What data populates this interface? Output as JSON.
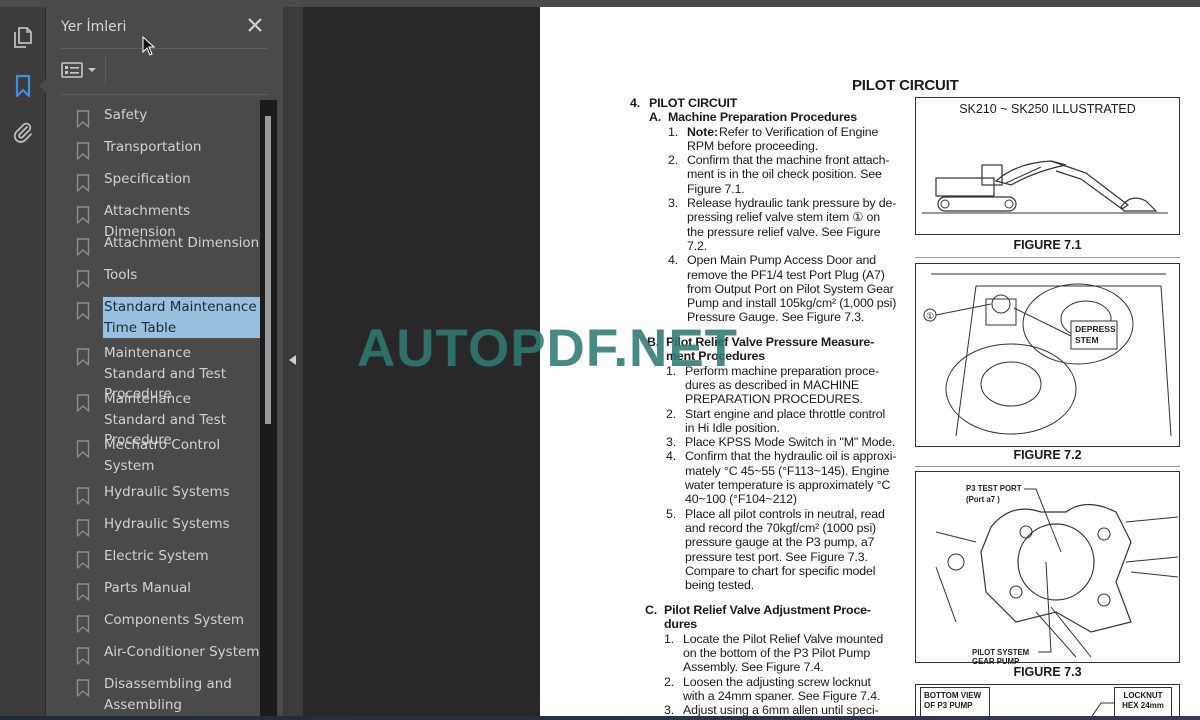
{
  "sidebar_rail": {
    "icons": [
      "pages-icon",
      "bookmark-icon",
      "attachment-icon"
    ],
    "active": "bookmark-icon"
  },
  "bookmarks_panel": {
    "title": "Yer İmleri",
    "close_label": "✕",
    "options_label": "Bookmark options",
    "items": [
      {
        "label": "Safety",
        "selected": false
      },
      {
        "label": "Transportation",
        "selected": false
      },
      {
        "label": "Specification",
        "selected": false
      },
      {
        "label": "Attachments Dimension",
        "selected": false
      },
      {
        "label": "Attachment Dimension",
        "selected": false
      },
      {
        "label": "Tools",
        "selected": false
      },
      {
        "label": "Standard Maintenance Time Table",
        "selected": true
      },
      {
        "label": "Maintenance Standard and Test Procedure",
        "selected": false
      },
      {
        "label": "Maintenance Standard and Test Procedure",
        "selected": false
      },
      {
        "label": "Mechatro Control System",
        "selected": false
      },
      {
        "label": "Hydraulic Systems",
        "selected": false
      },
      {
        "label": "Hydraulic Systems",
        "selected": false
      },
      {
        "label": "Electric System",
        "selected": false
      },
      {
        "label": "Parts Manual",
        "selected": false
      },
      {
        "label": "Components System",
        "selected": false
      },
      {
        "label": "Air-Conditioner System",
        "selected": false
      },
      {
        "label": "Disassembling and Assembling",
        "selected": false
      }
    ]
  },
  "watermark": "AUTOPDF.NET",
  "document": {
    "page_title": "PILOT CIRCUIT",
    "section": {
      "num": "4.",
      "title": "PILOT CIRCUIT"
    },
    "subsections": [
      {
        "letter": "A.",
        "title": "Machine Preparation Procedures",
        "steps": [
          {
            "num": "1.",
            "lead": "Note:",
            "lines": [
              "Refer to Verification of Engine",
              "RPM before proceeding."
            ]
          },
          {
            "num": "2.",
            "lines": [
              "Confirm that the machine front attach-",
              "ment is in the oil check position. See",
              "Figure 7.1."
            ]
          },
          {
            "num": "3.",
            "lines": [
              "Release hydraulic tank pressure by de-",
              "pressing relief valve stem item ① on",
              "the pressure relief valve. See Figure",
              "7.2."
            ]
          },
          {
            "num": "4.",
            "lines": [
              "Open Main Pump Access Door and",
              "remove the PF1/4 test Port Plug (A7)",
              "from Output Port on Pilot System Gear",
              "Pump and install 105kg/cm² (1,000 psi)",
              "Pressure Gauge. See Figure 7.3."
            ]
          }
        ]
      },
      {
        "letter": "B.",
        "title_lines": [
          "Pilot Relief Valve Pressure Measure-",
          "ment Procedures"
        ],
        "steps": [
          {
            "num": "1.",
            "lines": [
              "Perform machine preparation proce-",
              "dures as described in MACHINE",
              "PREPARATION PROCEDURES."
            ]
          },
          {
            "num": "2.",
            "lines": [
              "Start engine and place throttle control",
              "in Hi Idle position."
            ]
          },
          {
            "num": "3.",
            "lines": [
              "Place KPSS Mode Switch in \"M\" Mode."
            ]
          },
          {
            "num": "4.",
            "lines": [
              "Confirm that the hydraulic oil is approxi-",
              "mately °C 45~55 (°F113~145). Engine",
              "water temperature is approximately °C",
              "40~100 (°F104~212)"
            ]
          },
          {
            "num": "5.",
            "lines": [
              "Place all pilot controls in neutral, read",
              "and record the 70kgf/cm² (1000 psi)",
              "pressure gauge at the P3 pump, a7",
              "pressure test port. See Figure 7.3.",
              "Compare to chart for specific model",
              "being tested."
            ]
          }
        ]
      },
      {
        "letter": "C.",
        "title_lines": [
          "Pilot Relief Valve Adjustment Proce-",
          "dures"
        ],
        "steps": [
          {
            "num": "1.",
            "lines": [
              "Locate the Pilot Relief Valve mounted",
              "on the bottom of the P3 Pilot Pump",
              "Assembly. See Figure 7.4."
            ]
          },
          {
            "num": "2.",
            "lines": [
              "Loosen the adjusting screw locknut",
              "with a 24mm spaner. See Figure 7.4."
            ]
          },
          {
            "num": "3.",
            "lines": [
              "Adjust using a 6mm allen until speci-"
            ]
          }
        ]
      }
    ],
    "figures": [
      {
        "caption": "FIGURE 7.1",
        "label": "SK210 ~ SK250 ILLUSTRATED"
      },
      {
        "caption": "FIGURE 7.2",
        "callout_item": "①",
        "callout_label_1": "DEPRESS",
        "callout_label_2": "STEM"
      },
      {
        "caption": "FIGURE 7.3",
        "label_top_1": "P3 TEST PORT",
        "label_top_2": "(Port a7 )",
        "label_bottom_1": "PILOT SYSTEM",
        "label_bottom_2": "GEAR PUMP"
      },
      {
        "label_left_1": "BOTTOM VIEW",
        "label_left_2": "OF P3 PUMP",
        "label_right_1": "LOCKNUT",
        "label_right_2": "HEX 24mm"
      }
    ]
  }
}
